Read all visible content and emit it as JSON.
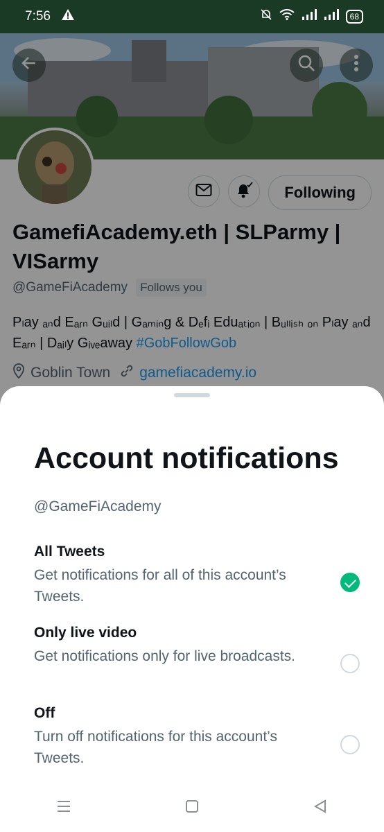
{
  "status_bar": {
    "time": "7:56",
    "battery": "68"
  },
  "profile": {
    "display_name": "GamefiAcademy.eth | SLParmy | VISarmy",
    "handle": "@GameFiAcademy",
    "follows_you": "Follows you",
    "bio_text": "Pₗay ₐₙd Eₐᵣₙ Gᵤᵢₗd | Gₐₘᵢₙg & Dₑfᵢ Eduₐₜᵢₒₙ | Bᵤₗₗᵢₛₕ ₒₙ Pₗay ₐₙd Eₐᵣₙ | Dₐᵢₗy Gᵢᵥₑaway",
    "bio_hashtag": "#GobFollowGob",
    "location": "Goblin Town",
    "website": "gamefiacademy.io",
    "follow_label": "Following"
  },
  "sheet": {
    "title": "Account notifications",
    "handle": "@GameFiAcademy",
    "options": [
      {
        "title": "All Tweets",
        "desc": "Get notifications for all of this account’s Tweets.",
        "selected": true
      },
      {
        "title": "Only live video",
        "desc": "Get notifications only for live broadcasts.",
        "selected": false
      },
      {
        "title": "Off",
        "desc": "Turn off notifications for this account’s Tweets.",
        "selected": false
      }
    ]
  },
  "icons": {
    "back": "back-arrow-icon",
    "search": "search-icon",
    "more": "more-vertical-icon",
    "message": "mail-icon",
    "notify": "bell-check-icon",
    "location": "location-pin-icon",
    "link": "link-icon"
  },
  "colors": {
    "accent": "#1d9bf0",
    "selected": "#00ba7c",
    "statusbar": "#1b3a25"
  }
}
